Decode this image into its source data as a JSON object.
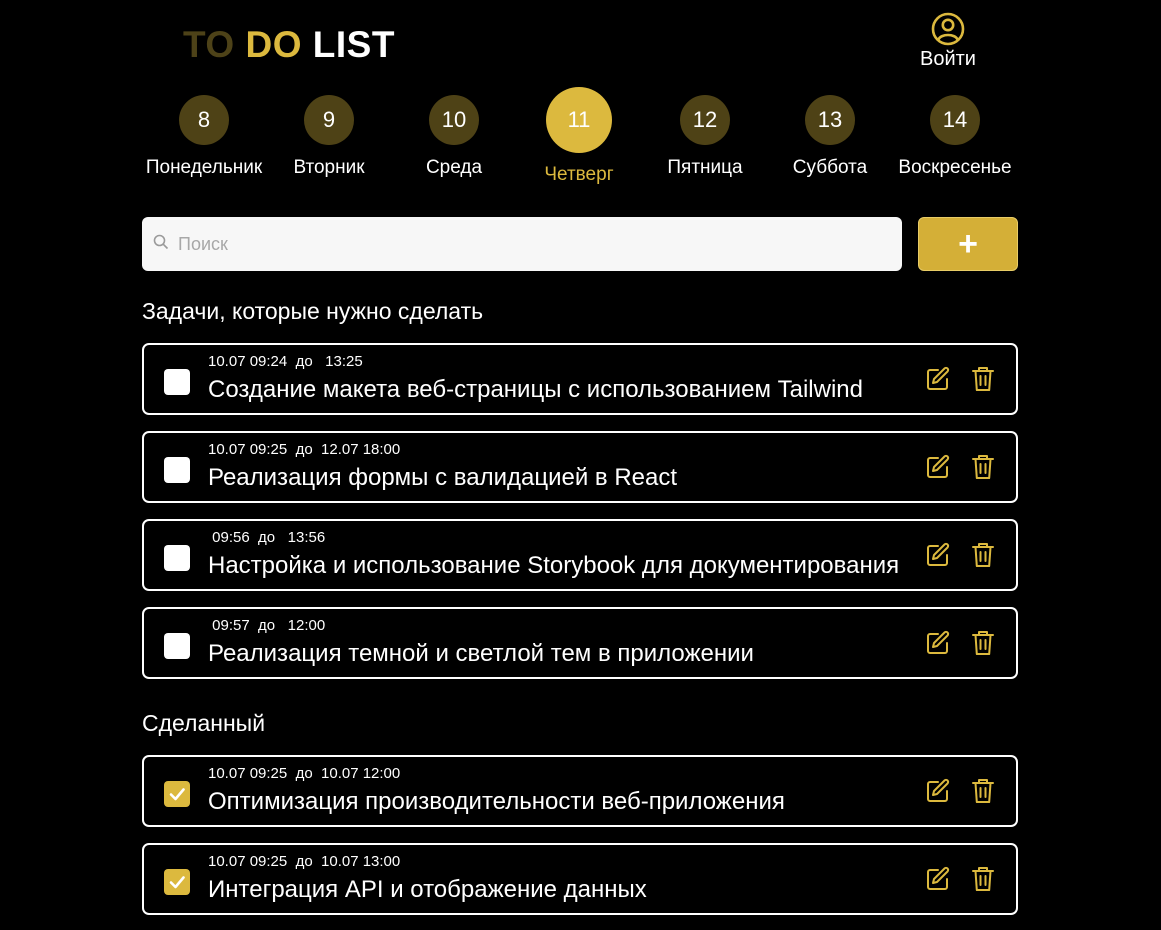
{
  "header": {
    "logo_word1": "TO",
    "logo_word2": "DO",
    "logo_word3": "LIST",
    "login_label": "Войти"
  },
  "colors": {
    "accent": "#dcb93e",
    "day_inactive": "#4e4216",
    "background": "#000000"
  },
  "days": [
    {
      "number": "8",
      "name": "Понедельник",
      "active": false
    },
    {
      "number": "9",
      "name": "Вторник",
      "active": false
    },
    {
      "number": "10",
      "name": "Среда",
      "active": false
    },
    {
      "number": "11",
      "name": "Четверг",
      "active": true
    },
    {
      "number": "12",
      "name": "Пятница",
      "active": false
    },
    {
      "number": "13",
      "name": "Суббота",
      "active": false
    },
    {
      "number": "14",
      "name": "Воскресенье",
      "active": false
    }
  ],
  "search": {
    "placeholder": "Поиск",
    "value": "",
    "icon": "search-icon"
  },
  "add_button": {
    "label": "+"
  },
  "todo_section": {
    "title": "Задачи, которые нужно сделать",
    "tasks": [
      {
        "time": "10.07 09:24  до   13:25",
        "title": "Создание макета веб-страницы с использованием Tailwind",
        "done": false
      },
      {
        "time": "10.07 09:25  до  12.07 18:00",
        "title": "Реализация формы с валидацией в React",
        "done": false
      },
      {
        "time": " 09:56  до   13:56",
        "title": "Настройка и использование Storybook для документирования",
        "done": false
      },
      {
        "time": " 09:57  до   12:00",
        "title": "Реализация темной и светлой тем в приложении",
        "done": false
      }
    ]
  },
  "done_section": {
    "title": "Сделанный",
    "tasks": [
      {
        "time": "10.07 09:25  до  10.07 12:00",
        "title": "Оптимизация производительности веб-приложения",
        "done": true
      },
      {
        "time": "10.07 09:25  до  10.07 13:00",
        "title": "Интеграция API и отображение данных",
        "done": true
      }
    ]
  }
}
